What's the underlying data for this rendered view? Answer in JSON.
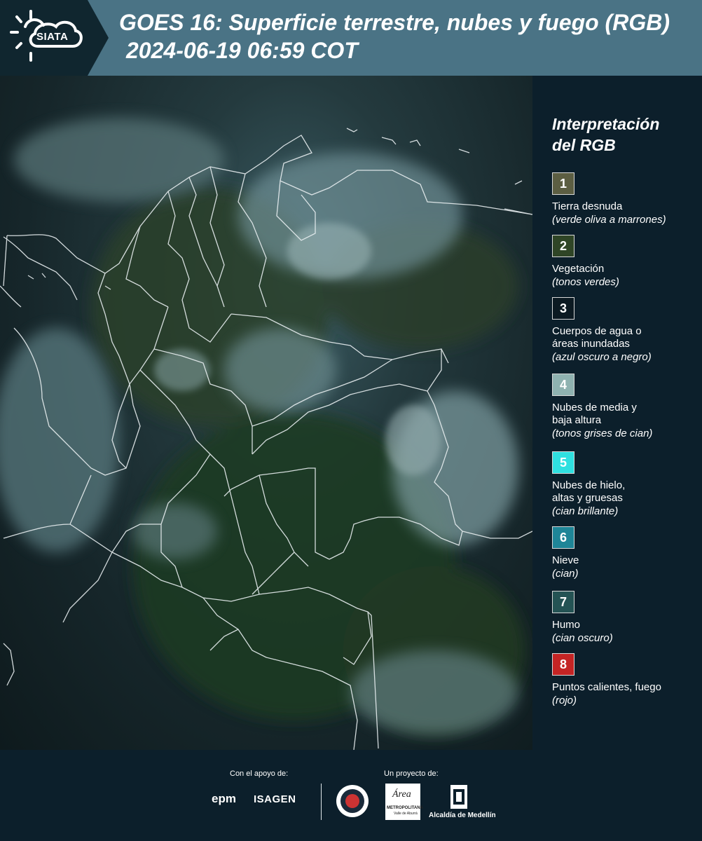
{
  "header": {
    "logo_text": "SIATA",
    "title_line1": "GOES 16: Superficie terrestre, nubes y fuego (RGB)",
    "title_line2": "2024-06-19 06:59 COT"
  },
  "legend": {
    "title_line1": "Interpretación",
    "title_line2": "del RGB",
    "items": [
      {
        "number": "1",
        "color": "#5c5e42",
        "lines": [
          "Tierra desnuda"
        ],
        "sub": "(verde oliva a marrones)"
      },
      {
        "number": "2",
        "color": "#2f4526",
        "lines": [
          "Vegetación"
        ],
        "sub": "(tonos verdes)"
      },
      {
        "number": "3",
        "color": "#0c1a22",
        "lines": [
          "Cuerpos de agua o",
          "áreas inundadas"
        ],
        "sub": "(azul oscuro a negro)"
      },
      {
        "number": "4",
        "color": "#8fb2b0",
        "lines": [
          "Nubes de media y",
          "baja altura"
        ],
        "sub": "(tonos grises de cian)"
      },
      {
        "number": "5",
        "color": "#2fe0e0",
        "lines": [
          "Nubes de hielo,",
          "altas y gruesas"
        ],
        "sub": "(cian brillante)"
      },
      {
        "number": "6",
        "color": "#1e8597",
        "lines": [
          "Nieve"
        ],
        "sub": "(cian)"
      },
      {
        "number": "7",
        "color": "#245354",
        "lines": [
          "Humo"
        ],
        "sub": "(cian oscuro)"
      },
      {
        "number": "8",
        "color": "#c42424",
        "lines": [
          "Puntos calientes, fuego"
        ],
        "sub": "(rojo)"
      }
    ]
  },
  "footer": {
    "support_label": "Con el apoyo de:",
    "project_label": "Un proyecto de:",
    "epm": "epm",
    "isagen": "ISAGEN",
    "area_logo_text": "Área",
    "area_sub": "METROPOLITANA",
    "area_sub2": "Valle de Aburrá",
    "medellin_label": "Alcaldía de Medellín"
  },
  "colors": {
    "header_bg": "#4a7385",
    "page_bg": "#0c1f2b"
  }
}
